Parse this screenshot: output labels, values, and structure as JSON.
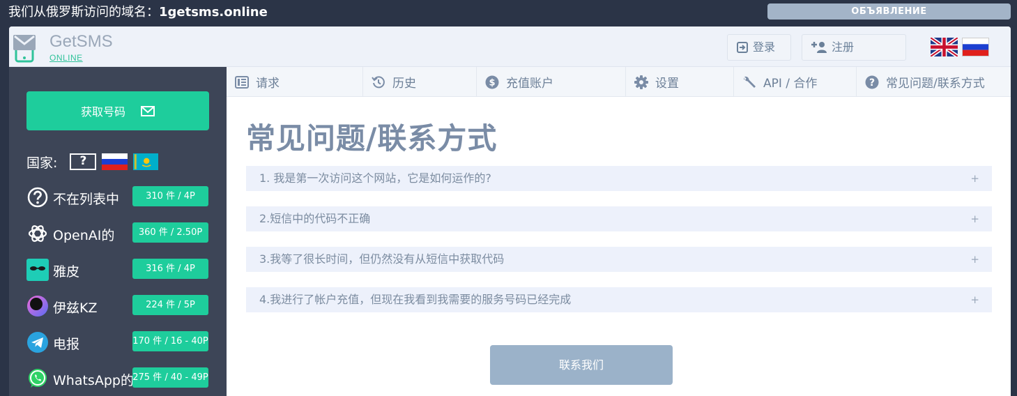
{
  "topbar": {
    "domain_prefix": "我们从俄罗斯访问的域名：",
    "domain_name": "1getsms.online",
    "announcement_label": "ОБЪЯВЛЕНИЕ"
  },
  "header": {
    "logo_name": "GetSMS",
    "logo_sub": "ONLINE",
    "login_label": "登录",
    "register_label": "注册"
  },
  "sidebar": {
    "get_number_label": "获取号码",
    "country_label": "国家:",
    "unknown_flag_text": "?",
    "services": [
      {
        "name": "不在列表中",
        "price": "310 件 / 4P",
        "icon": "question-circle-icon"
      },
      {
        "name": "OpenAI的",
        "price": "360 件 / 2.50P",
        "icon": "openai-icon"
      },
      {
        "name": "雅皮",
        "price": "316 件 / 4P",
        "icon": "yappy-icon"
      },
      {
        "name": "伊兹KZ",
        "price": "224 件 / 5P",
        "icon": "izi-icon"
      },
      {
        "name": "电报",
        "price": "170 件 / 16 - 40P",
        "icon": "telegram-icon"
      },
      {
        "name": "WhatsApp的",
        "price": "275 件 / 40 - 49P",
        "icon": "whatsapp-icon"
      }
    ]
  },
  "nav": {
    "tabs": [
      {
        "label": "请求",
        "icon": "list-icon"
      },
      {
        "label": "历史",
        "icon": "history-icon"
      },
      {
        "label": "充值账户",
        "icon": "dollar-icon"
      },
      {
        "label": "设置",
        "icon": "gear-icon"
      },
      {
        "label": "API / 合作",
        "icon": "wrench-icon"
      },
      {
        "label": "常见问题/联系方式",
        "icon": "question-icon"
      }
    ]
  },
  "main": {
    "title": "常见问题/联系方式",
    "faq": [
      {
        "question": "1. 我是第一次访问这个网站，它是如何运作的?",
        "toggle": "+"
      },
      {
        "question": "2.短信中的代码不正确",
        "toggle": "+"
      },
      {
        "question": "3.我等了很长时间，但仍然没有从短信中获取代码",
        "toggle": "+"
      },
      {
        "question": "4.我进行了帐户充值，但现在我看到我需要的服务号码已经完成",
        "toggle": "+"
      }
    ],
    "contact_label": "联系我们"
  },
  "colors": {
    "page_bg": "#2b3447",
    "sidebar_bg": "#3d4557",
    "accent_green": "#1ecd9c",
    "announce_bg": "#a3b4c8",
    "contact_bg": "#9bb2c9",
    "faq_bg": "#edf1fb"
  }
}
